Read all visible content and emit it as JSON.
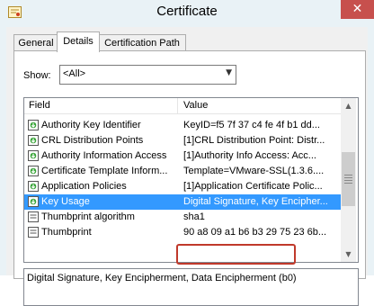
{
  "window": {
    "title": "Certificate",
    "close_glyph": "✕"
  },
  "tabs": [
    {
      "label": "General",
      "active": false
    },
    {
      "label": "Details",
      "active": true
    },
    {
      "label": "Certification Path",
      "active": false
    }
  ],
  "show": {
    "label": "Show:",
    "selected": "<All>"
  },
  "list": {
    "columns": {
      "field": "Field",
      "value": "Value"
    },
    "rows": [
      {
        "field": "Authority Key Identifier",
        "value": "KeyID=f5 7f 37 c4 fe 4f b1 dd...",
        "icon": "cert-extension-icon"
      },
      {
        "field": "CRL Distribution Points",
        "value": "[1]CRL Distribution Point: Distr...",
        "icon": "cert-extension-icon"
      },
      {
        "field": "Authority Information Access",
        "value": "[1]Authority Info Access: Acc...",
        "icon": "cert-extension-icon"
      },
      {
        "field": "Certificate Template Inform...",
        "value": "Template=VMware-SSL(1.3.6....",
        "icon": "cert-extension-icon"
      },
      {
        "field": "Application Policies",
        "value": "[1]Application Certificate Polic...",
        "icon": "cert-extension-icon"
      },
      {
        "field": "Key Usage",
        "value": "Digital Signature, Key Encipher...",
        "icon": "cert-extension-icon",
        "selected": true
      },
      {
        "field": "Thumbprint algorithm",
        "value": "sha1",
        "icon": "cert-property-icon"
      },
      {
        "field": "Thumbprint",
        "value": "90 a8 09 a1 b6 b3 29 75 23 6b...",
        "icon": "cert-property-icon"
      }
    ]
  },
  "detail": {
    "value": "Digital Signature, Key Encipherment, Data Encipherment (b0)"
  },
  "colors": {
    "selection": "#3399ff",
    "highlight_border": "#c0392b",
    "close_button": "#c7504d"
  }
}
